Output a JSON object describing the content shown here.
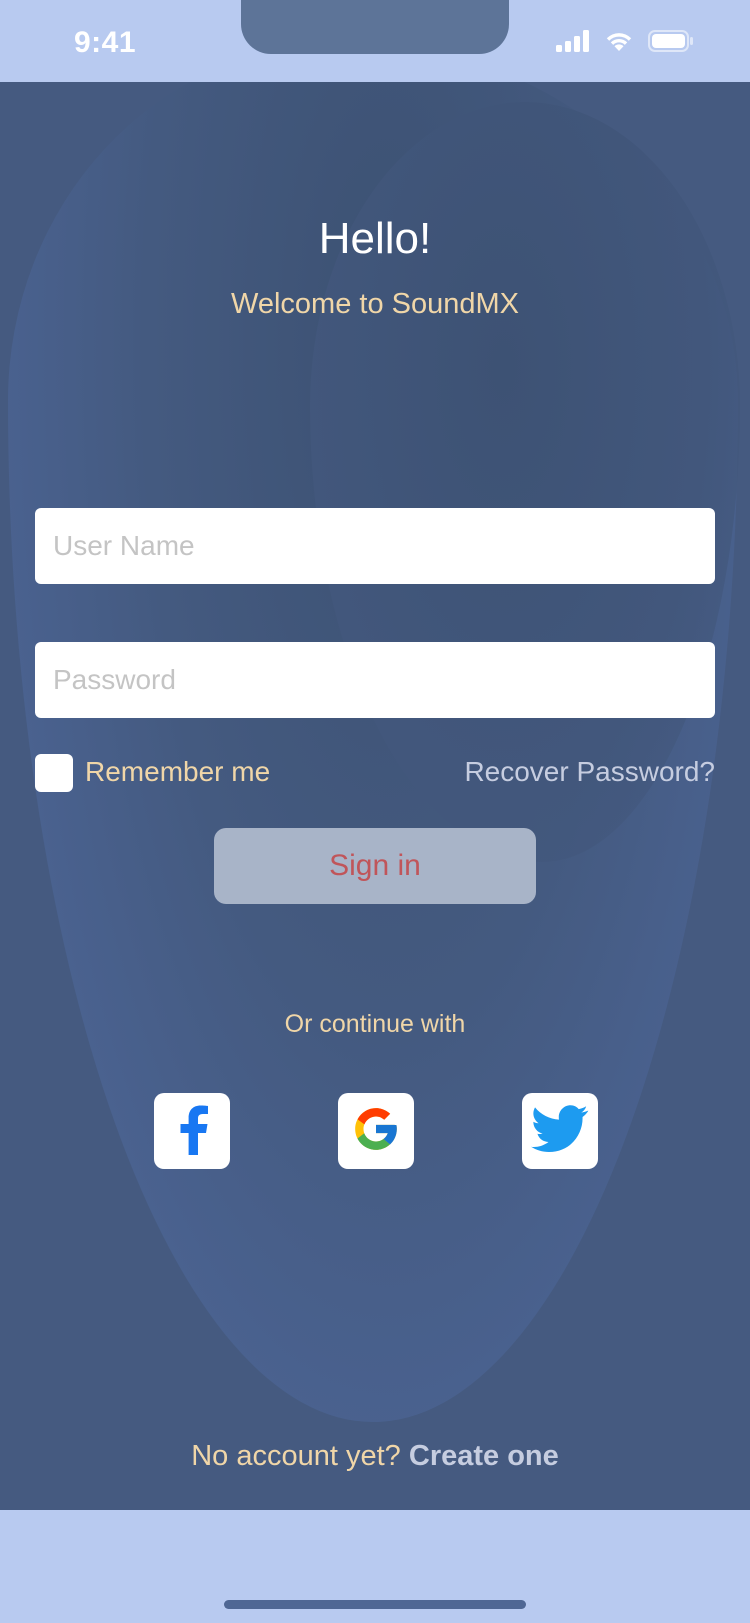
{
  "status_bar": {
    "time": "9:41"
  },
  "header": {
    "title": "Hello!",
    "subtitle": "Welcome to SoundMX"
  },
  "form": {
    "username_placeholder": "User Name",
    "password_placeholder": "Password",
    "remember_label": "Remember me",
    "remember_checked": false,
    "recover_label": "Recover Password?",
    "signin_label": "Sign in"
  },
  "social": {
    "heading": "Or continue with",
    "providers": [
      "facebook-icon",
      "google-icon",
      "twitter-icon"
    ]
  },
  "footer": {
    "prompt": "No account yet?",
    "link": "Create one"
  },
  "colors": {
    "background": "#455a80",
    "accent_text": "#f0d6a8",
    "link_text": "#c6cde0",
    "signin_text": "#c0555a",
    "status_bar": "#b8caf0"
  }
}
